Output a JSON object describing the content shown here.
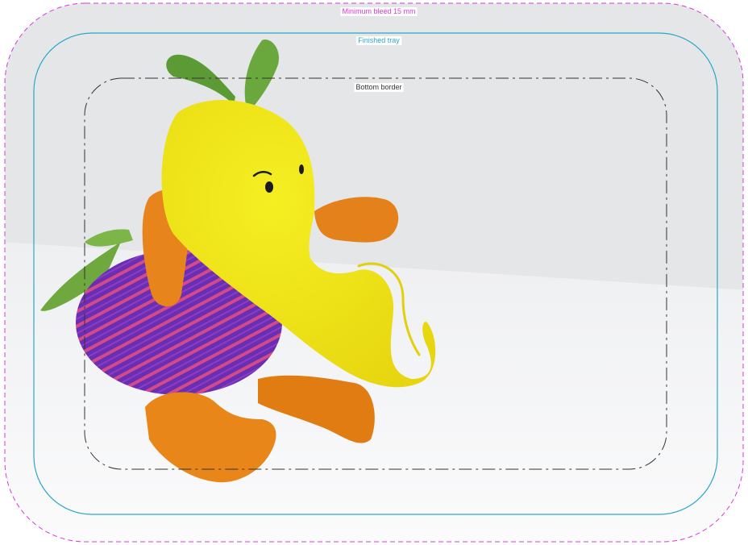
{
  "guides": {
    "bleed_label": "Minimum bleed 15 mm",
    "tray_label": "Finished tray",
    "border_label": "Bottom border"
  },
  "colors": {
    "bleed_line": "#d83ad8",
    "tray_line": "#2aa7c9",
    "border_line": "#333333",
    "backdrop": "#e6e7e9",
    "surface": "#f7f7f8"
  }
}
